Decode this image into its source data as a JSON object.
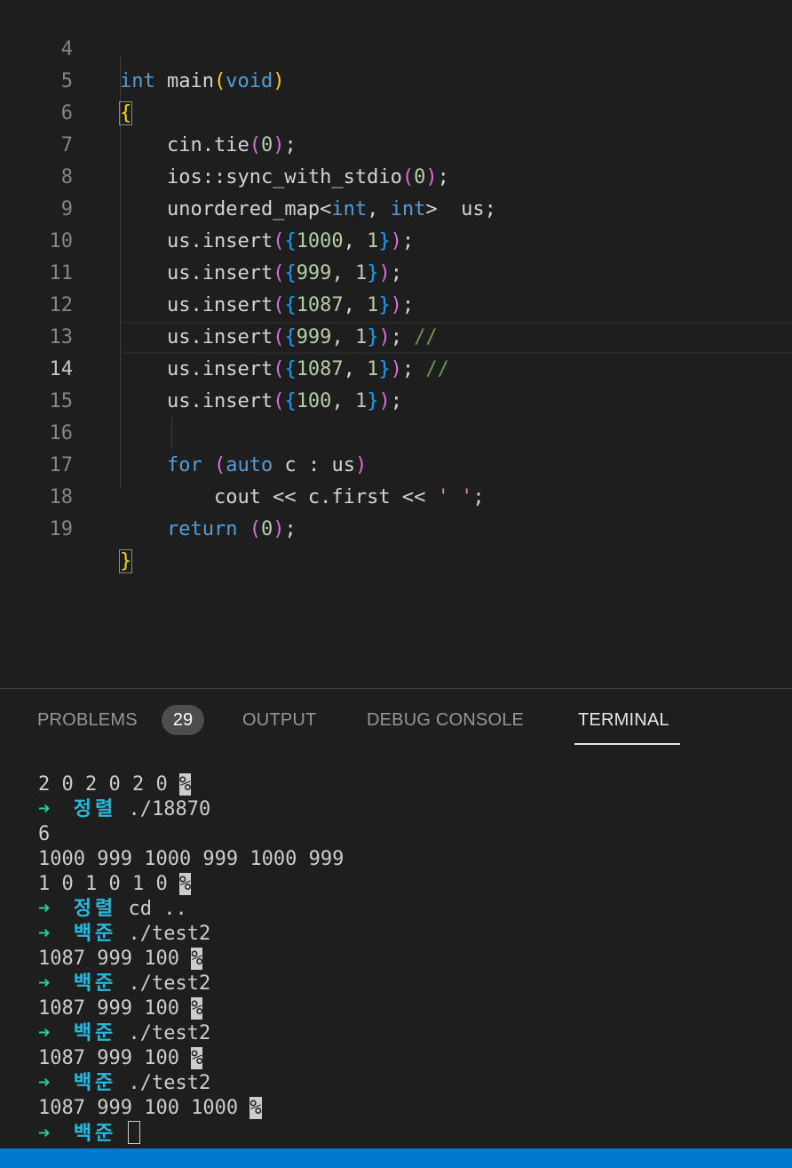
{
  "editor": {
    "lines": [
      {
        "n": "4",
        "code": "int main(void)"
      },
      {
        "n": "5",
        "code": "{"
      },
      {
        "n": "6",
        "code": "    cin.tie(0);"
      },
      {
        "n": "7",
        "code": "    ios::sync_with_stdio(0);"
      },
      {
        "n": "8",
        "code": "    unordered_map<int, int>  us;"
      },
      {
        "n": "9",
        "code": "    us.insert({1000, 1});"
      },
      {
        "n": "10",
        "code": "    us.insert({999, 1});"
      },
      {
        "n": "11",
        "code": "    us.insert({1087, 1});"
      },
      {
        "n": "12",
        "code": "    us.insert({999, 1}); //"
      },
      {
        "n": "13",
        "code": "    us.insert({1087, 1}); //"
      },
      {
        "n": "14",
        "code": "    us.insert({100, 1});"
      },
      {
        "n": "15",
        "code": ""
      },
      {
        "n": "16",
        "code": "    for (auto c : us)"
      },
      {
        "n": "17",
        "code": "        cout << c.first << ' ';"
      },
      {
        "n": "18",
        "code": "    return (0);"
      },
      {
        "n": "19",
        "code": "}"
      }
    ]
  },
  "panel": {
    "tabs": {
      "problems": "PROBLEMS",
      "problems_count": "29",
      "output": "OUTPUT",
      "debug_console": "DEBUG CONSOLE",
      "terminal": "TERMINAL"
    }
  },
  "terminal": {
    "arrow": "➜",
    "lines": [
      {
        "type": "out",
        "text": "2 0 2 0 2 0 ",
        "pct": "%"
      },
      {
        "type": "prompt",
        "dir": "정렬",
        "cmd": "./18870"
      },
      {
        "type": "out",
        "text": "6"
      },
      {
        "type": "out",
        "text": "1000 999 1000 999 1000 999"
      },
      {
        "type": "out",
        "text": "1 0 1 0 1 0 ",
        "pct": "%"
      },
      {
        "type": "prompt",
        "dir": "정렬",
        "cmd": "cd .."
      },
      {
        "type": "prompt",
        "dir": "백준",
        "cmd": "./test2"
      },
      {
        "type": "out",
        "text": "1087 999 100 ",
        "pct": "%"
      },
      {
        "type": "prompt",
        "dir": "백준",
        "cmd": "./test2"
      },
      {
        "type": "out",
        "text": "1087 999 100 ",
        "pct": "%"
      },
      {
        "type": "prompt",
        "dir": "백준",
        "cmd": "./test2"
      },
      {
        "type": "out",
        "text": "1087 999 100 ",
        "pct": "%"
      },
      {
        "type": "prompt",
        "dir": "백준",
        "cmd": "./test2"
      },
      {
        "type": "out",
        "text": "1087 999 100 1000 ",
        "pct": "%"
      },
      {
        "type": "prompt",
        "dir": "백준",
        "cmd": "",
        "cursor": true
      }
    ]
  },
  "colors": {
    "background": "#1e1e1e",
    "keyword": "#569cd6",
    "control": "#c586c0",
    "number": "#b5cea8",
    "string": "#ce9178",
    "comment": "#6a9955",
    "prompt_arrow": "#23d18b",
    "prompt_dir": "#29b8db",
    "statusbar": "#007acc"
  }
}
